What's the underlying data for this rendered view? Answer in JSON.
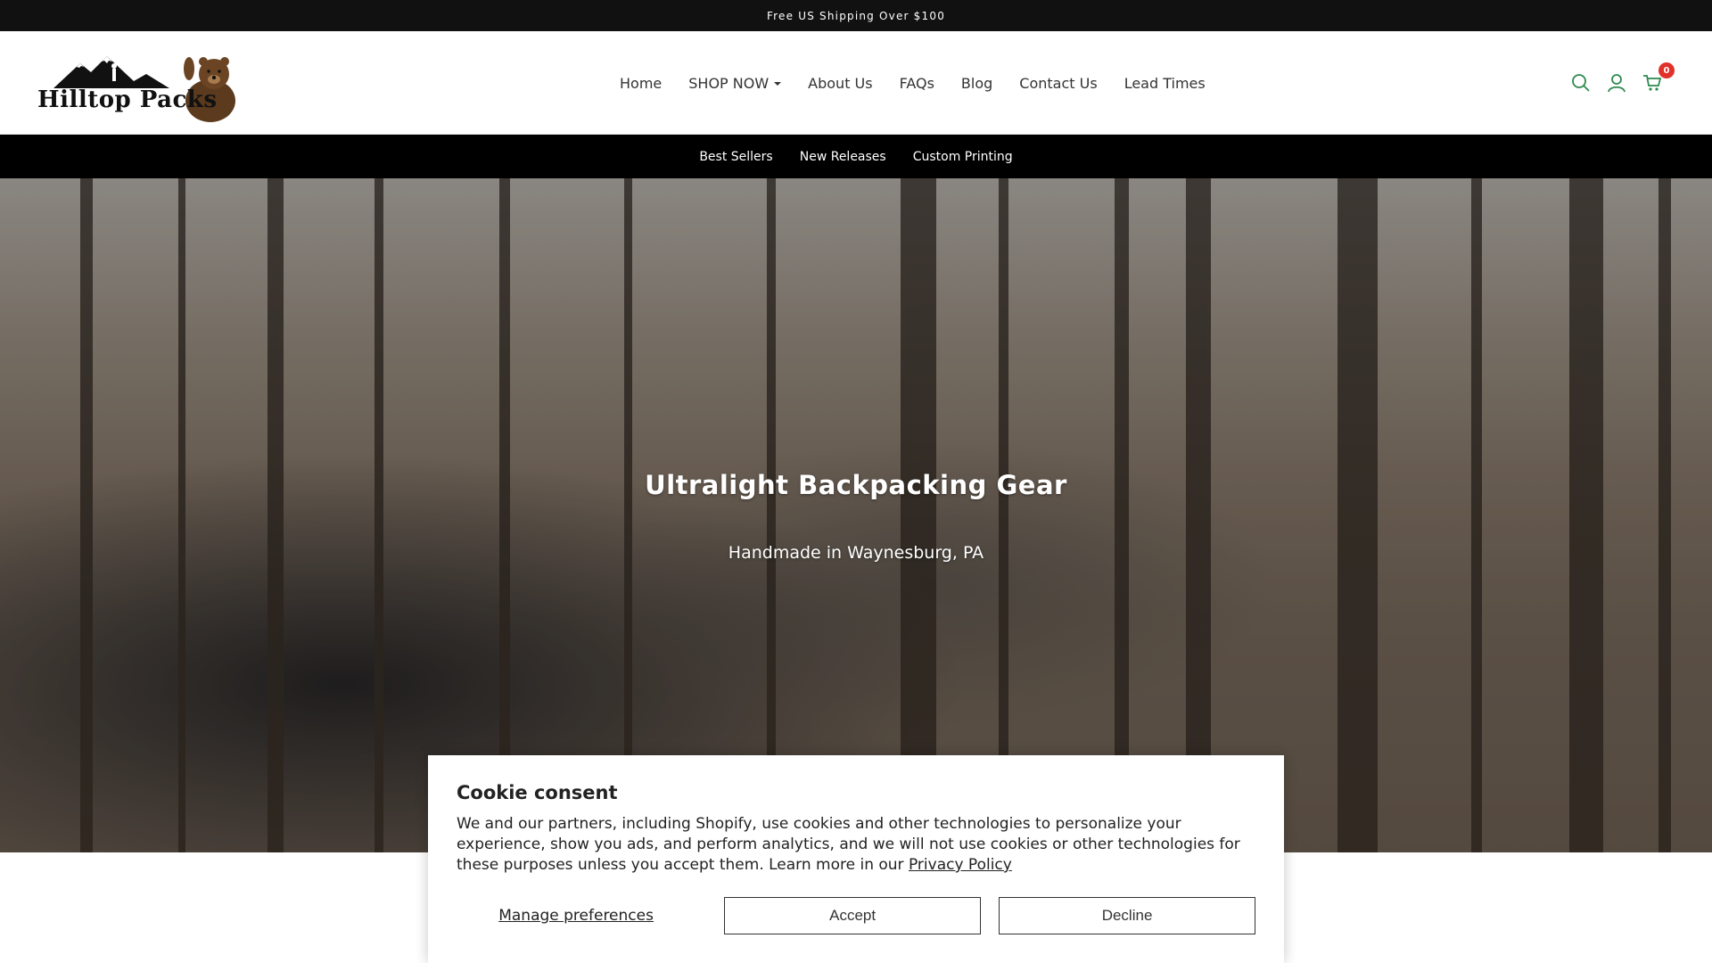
{
  "announcement": {
    "text": "Free US Shipping Over $100"
  },
  "logo": {
    "text": "Hilltop Packs"
  },
  "nav": {
    "items": [
      {
        "label": "Home"
      },
      {
        "label": "SHOP NOW",
        "dropdown": true
      },
      {
        "label": "About Us"
      },
      {
        "label": "FAQs"
      },
      {
        "label": "Blog"
      },
      {
        "label": "Contact Us"
      },
      {
        "label": "Lead Times"
      }
    ]
  },
  "header_icons": {
    "search": "search-icon",
    "account": "user-icon",
    "cart": "cart-icon",
    "cart_count": "0",
    "accent": "#e0322b"
  },
  "subnav": {
    "items": [
      {
        "label": "Best Sellers"
      },
      {
        "label": "New Releases"
      },
      {
        "label": "Custom Printing"
      }
    ]
  },
  "hero": {
    "title": "Ultralight Backpacking Gear",
    "subtitle": "Handmade in Waynesburg, PA"
  },
  "cookie": {
    "title": "Cookie consent",
    "body": "We and our partners, including Shopify, use cookies and other technologies to personalize your experience, show you ads, and perform analytics, and we will not use cookies or other technologies for these purposes unless you accept them. Learn more in our ",
    "privacy_link": "Privacy Policy",
    "manage_label": "Manage preferences",
    "accept_label": "Accept",
    "decline_label": "Decline"
  }
}
